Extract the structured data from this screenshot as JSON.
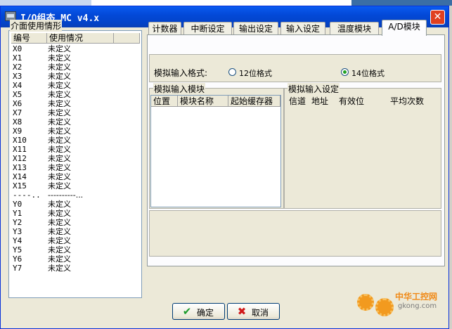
{
  "window": {
    "title": "I/O组态 MC v4.x",
    "close_label": "✕"
  },
  "usage": {
    "group_title": "介面使用情形",
    "columns": [
      "编号",
      "使用情况"
    ],
    "rows": [
      {
        "id": "X0",
        "status": "未定义"
      },
      {
        "id": "X1",
        "status": "未定义"
      },
      {
        "id": "X2",
        "status": "未定义"
      },
      {
        "id": "X3",
        "status": "未定义"
      },
      {
        "id": "X4",
        "status": "未定义"
      },
      {
        "id": "X5",
        "status": "未定义"
      },
      {
        "id": "X6",
        "status": "未定义"
      },
      {
        "id": "X7",
        "status": "未定义"
      },
      {
        "id": "X8",
        "status": "未定义"
      },
      {
        "id": "X9",
        "status": "未定义"
      },
      {
        "id": "X10",
        "status": "未定义"
      },
      {
        "id": "X11",
        "status": "未定义"
      },
      {
        "id": "X12",
        "status": "未定义"
      },
      {
        "id": "X13",
        "status": "未定义"
      },
      {
        "id": "X14",
        "status": "未定义"
      },
      {
        "id": "X15",
        "status": "未定义"
      },
      {
        "id": "----..",
        "status": "----------..."
      },
      {
        "id": "Y0",
        "status": "未定义"
      },
      {
        "id": "Y1",
        "status": "未定义"
      },
      {
        "id": "Y2",
        "status": "未定义"
      },
      {
        "id": "Y3",
        "status": "未定义"
      },
      {
        "id": "Y4",
        "status": "未定义"
      },
      {
        "id": "Y5",
        "status": "未定义"
      },
      {
        "id": "Y6",
        "status": "未定义"
      },
      {
        "id": "Y7",
        "status": "未定义"
      }
    ]
  },
  "tabs": {
    "items": [
      "计数器",
      "中断设定",
      "输出设定",
      "输入设定",
      "温度模块",
      "A/D模块"
    ],
    "active": "A/D模块"
  },
  "ad": {
    "format_label": "模拟输入格式:",
    "options": [
      {
        "label": "12位格式",
        "selected": false
      },
      {
        "label": "14位格式",
        "selected": true
      }
    ],
    "module_group_title": "模拟输入模块",
    "module_columns": [
      "位置",
      "模块名称",
      "起始缓存器"
    ],
    "settings_group_title": "模拟输入设定",
    "settings_columns": [
      "信道",
      "地址",
      "有效位",
      "平均次数"
    ]
  },
  "buttons": {
    "ok": "确定",
    "cancel": "取消"
  },
  "watermark": {
    "name": "中华工控网",
    "url": "gkong.com"
  },
  "colors": {
    "titlebar": "#0349d8",
    "close_button": "#e04020",
    "window_face": "#ece9d8",
    "ok_icon": "#1a9a2a",
    "cancel_icon": "#d01818",
    "watermark": "#f08a18"
  }
}
